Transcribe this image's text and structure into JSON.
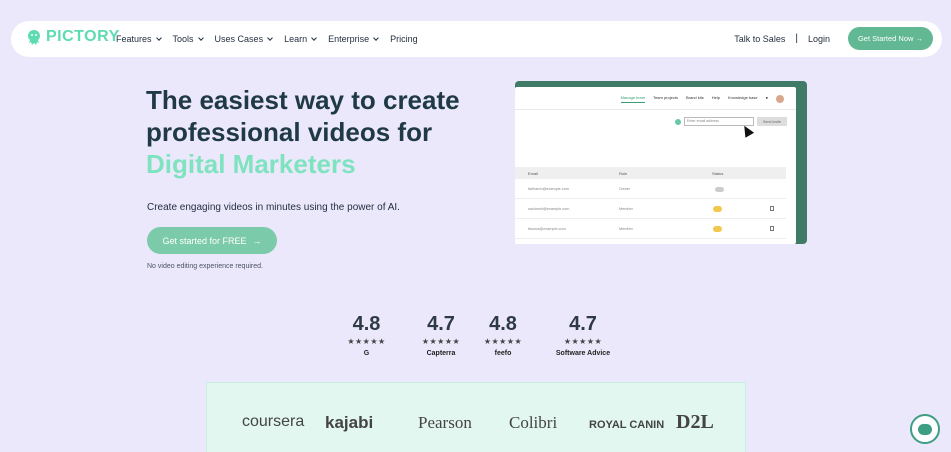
{
  "nav": {
    "logo": "PICTORY",
    "menu": [
      {
        "label": "Features",
        "dropdown": true
      },
      {
        "label": "Tools",
        "dropdown": true
      },
      {
        "label": "Uses Cases",
        "dropdown": true
      },
      {
        "label": "Learn",
        "dropdown": true
      },
      {
        "label": "Enterprise",
        "dropdown": true
      },
      {
        "label": "Pricing",
        "dropdown": false
      }
    ],
    "talk_to_sales": "Talk to Sales",
    "separator": "|",
    "login": "Login",
    "cta": "Get Started Now →"
  },
  "hero": {
    "title_line1": "The easiest way to create",
    "title_line2": "professional videos for",
    "title_accent": "Digital Marketers",
    "subtitle": "Create engaging videos in minutes using the power of AI.",
    "cta": "Get started for FREE",
    "cta_arrow": "→",
    "note": "No video editing experience required."
  },
  "mockup": {
    "tabs": [
      "Manage team",
      "Team projects",
      "Brand kits",
      "Help",
      "Knowledge base"
    ],
    "invite_placeholder": "Enter email address",
    "invite_button": "Send Invite",
    "columns": [
      "Email",
      "Role",
      "Status"
    ],
    "rows": [
      {
        "email": "faithamb@example.com",
        "role": "Owner"
      },
      {
        "email": "sachsmit@example.com",
        "role": "Member"
      },
      {
        "email": "bkuma@example.com",
        "role": "Member"
      }
    ]
  },
  "ratings": [
    {
      "score": "4.8",
      "source": "G"
    },
    {
      "score": "4.7",
      "source": "Capterra"
    },
    {
      "score": "4.8",
      "source": "feefo"
    },
    {
      "score": "4.7",
      "source": "Software Advice"
    }
  ],
  "stars": "★★★★★",
  "brands": [
    "coursera",
    "kajabi",
    "Pearson",
    "Colibri",
    "ROYAL CANIN",
    "D2L"
  ],
  "colors": {
    "background": "#ece8fb",
    "accent": "#7fe3c0",
    "cta": "#62b892",
    "heading": "#1f3a44"
  }
}
